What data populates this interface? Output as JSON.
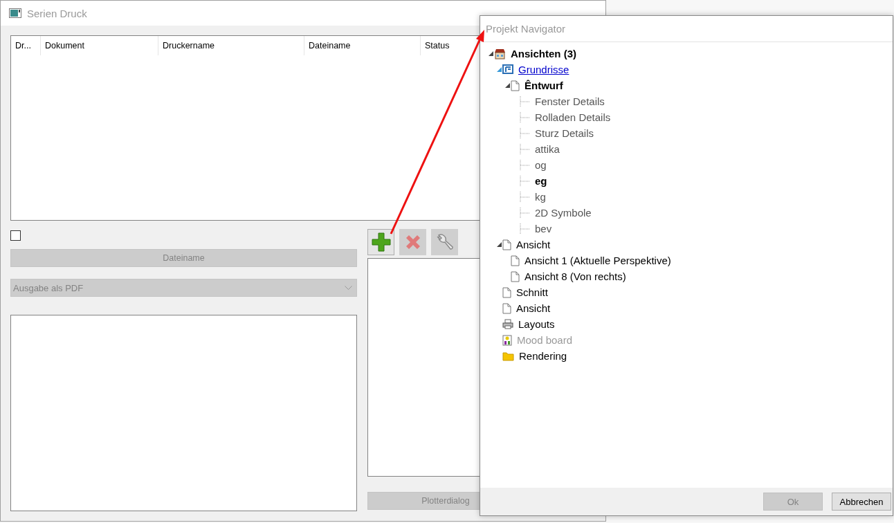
{
  "print_window": {
    "title": "Serien Druck",
    "table": {
      "columns": [
        "Dr...",
        "Dokument",
        "Druckername",
        "Dateiname",
        "Status"
      ]
    },
    "checkbox": {
      "checked": false
    },
    "filename_button": {
      "label": "Dateiname",
      "disabled": true
    },
    "output_select": {
      "value": "Ausgabe als PDF",
      "disabled": true
    },
    "toolbar": [
      {
        "kind": "add",
        "disabled": false
      },
      {
        "kind": "delete",
        "disabled": true
      },
      {
        "kind": "settings",
        "disabled": true
      }
    ],
    "plotter_button": {
      "label": "Plotterdialog",
      "disabled": true
    }
  },
  "navigator": {
    "title": "Projekt Navigator",
    "tree": [
      {
        "label": "Ansichten (3)",
        "kind": "category",
        "expanded": true,
        "children": [
          {
            "label": "Grundrisse",
            "kind": "floorplans",
            "expanded": true,
            "children": [
              {
                "label": "Êntwurf",
                "kind": "design",
                "expanded": true,
                "children": [
                  {
                    "label": "Fenster Details",
                    "kind": "layer"
                  },
                  {
                    "label": "Rolladen Details",
                    "kind": "layer"
                  },
                  {
                    "label": "Sturz Details",
                    "kind": "layer"
                  },
                  {
                    "label": "attika",
                    "kind": "layer"
                  },
                  {
                    "label": "og",
                    "kind": "layer"
                  },
                  {
                    "label": "eg",
                    "kind": "activelayer"
                  },
                  {
                    "label": "kg",
                    "kind": "layer"
                  },
                  {
                    "label": "2D Symbole",
                    "kind": "layer"
                  },
                  {
                    "label": "bev",
                    "kind": "layer"
                  }
                ]
              }
            ]
          },
          {
            "label": "Ansicht",
            "kind": "page",
            "expanded": true,
            "children": [
              {
                "label": "Ansicht 1 (Aktuelle Perspektive)",
                "kind": "page"
              },
              {
                "label": "Ansicht 8 (Von rechts)",
                "kind": "page"
              }
            ]
          },
          {
            "label": "Schnitt",
            "kind": "page"
          },
          {
            "label": "Ansicht",
            "kind": "page"
          },
          {
            "label": "Layouts",
            "kind": "layouts"
          },
          {
            "label": "Mood board",
            "kind": "moodboard"
          },
          {
            "label": "Rendering",
            "kind": "folder"
          }
        ]
      }
    ],
    "buttons": [
      {
        "label": "Ok",
        "disabled": true
      },
      {
        "label": "Abbrechen",
        "disabled": false
      }
    ]
  }
}
